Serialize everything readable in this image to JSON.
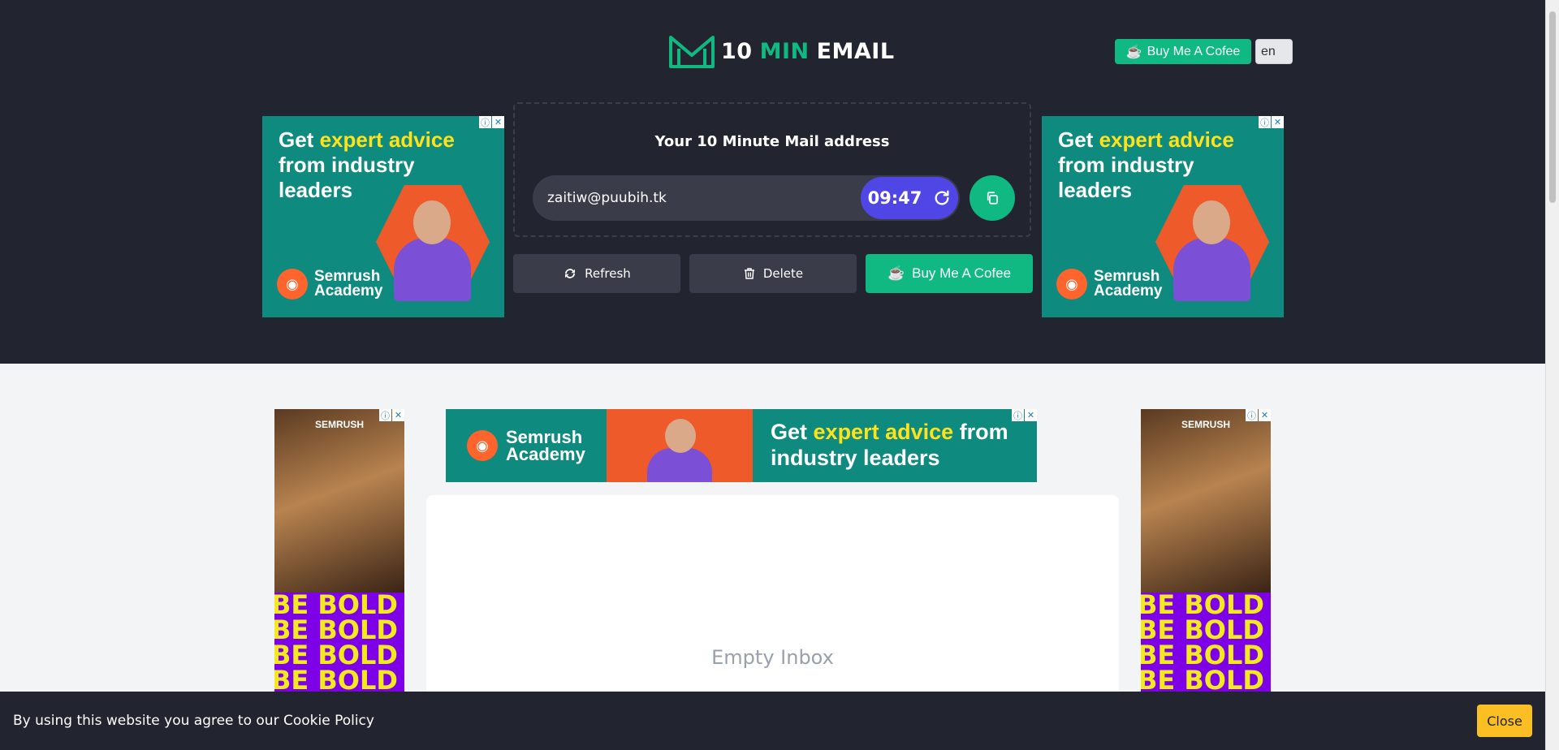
{
  "header": {
    "logo": {
      "part1": "10",
      "part2": "MIN",
      "part3": "EMAIL"
    },
    "buy_coffee_label": "Buy Me A Cofee",
    "language": "en"
  },
  "mail": {
    "title": "Your 10 Minute Mail address",
    "address": "zaitiw@puubih.tk",
    "timer": "09:47"
  },
  "actions": {
    "refresh_label": "Refresh",
    "delete_label": "Delete",
    "coffee_label": "Buy Me A Cofee"
  },
  "ads": {
    "top": {
      "headline_pre": "Get",
      "headline_highlight": "expert advice",
      "headline_post": "from industry leaders",
      "brand_line1": "Semrush",
      "brand_line2": "Academy"
    },
    "side": {
      "brand": "SEMRUSH",
      "slogan": "BE BOLD"
    },
    "banner": {
      "brand_line1": "Semrush",
      "brand_line2": "Academy",
      "headline_pre": "Get",
      "headline_highlight": "expert advice",
      "headline_post": "from industry leaders"
    }
  },
  "inbox": {
    "empty_text": "Empty Inbox"
  },
  "cookie": {
    "text": "By using this website you agree to our Cookie Policy",
    "close_label": "Close"
  },
  "colors": {
    "header_bg": "#22252f",
    "accent_green": "#10b981",
    "timer_purple": "#5046e5",
    "ad_teal": "#0e8a7e",
    "close_yellow": "#fbbf24"
  }
}
